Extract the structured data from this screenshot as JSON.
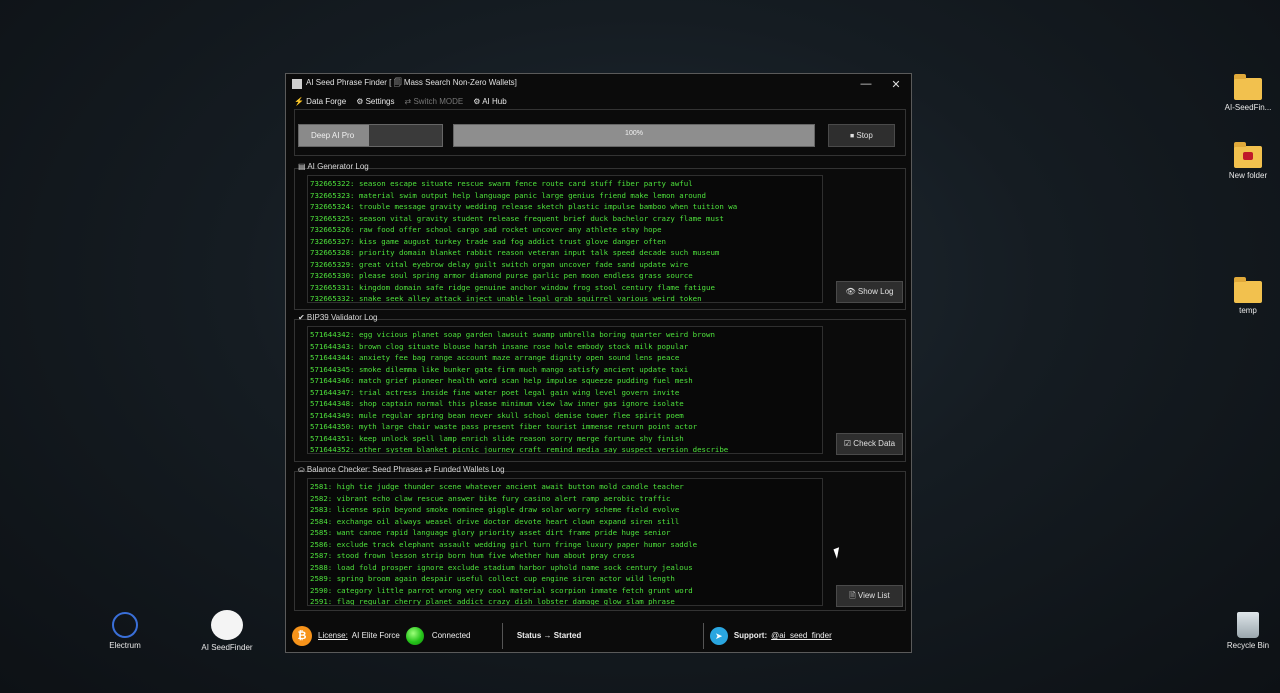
{
  "window": {
    "title": "AI Seed Phrase Finder [ 🗐 Mass Search Non-Zero Wallets]",
    "minimize": "—",
    "close": "✕"
  },
  "menu": {
    "data_forge": "⚡ Data Forge",
    "settings": "⚙ Settings",
    "switch_mode": "⇄ Switch MODE",
    "ai_hub": "⚙ AI Hub"
  },
  "controls": {
    "mode_selected": "Deep AI Pro",
    "progress_text": "100%",
    "progress_fraction": 1.0,
    "stop_label": "⏹ Stop"
  },
  "generator": {
    "label": "▤ AI Generator Log",
    "button": "👁 Show Log",
    "lines": [
      "732665322: season escape situate rescue swarm fence route card stuff fiber party awful",
      "732665323: material swim output help language panic large genius friend make lemon around",
      "732665324: trouble message gravity wedding release sketch plastic impulse bamboo when tuition wa",
      "732665325: season vital gravity student release frequent brief duck bachelor crazy flame must",
      "732665326: raw food offer school cargo sad rocket uncover any athlete stay hope",
      "732665327: kiss game august turkey trade sad fog addict trust glove danger often",
      "732665328: priority domain blanket rabbit reason veteran input talk speed decade such museum",
      "732665329: great vital eyebrow delay guilt switch organ uncover fade sand update wire",
      "732665330: please soul spring armor diamond purse garlic pen moon endless grass source",
      "732665331: kingdom domain safe ridge genuine anchor window frog stool century flame fatigue",
      "732665332: snake seek alley attack inject unable legal grab squirrel various weird token"
    ]
  },
  "validator": {
    "label": "✔ BIP39 Validator Log",
    "button": "☑ Check Data",
    "lines": [
      "571644342: egg vicious planet soap garden lawsuit swamp umbrella boring quarter weird brown",
      "571644343: brown clog situate blouse harsh insane rose hole embody stock milk popular",
      "571644344: anxiety fee bag range account maze arrange dignity open sound lens peace",
      "571644345: smoke dilemma like bunker gate firm much mango satisfy ancient update taxi",
      "571644346: match grief pioneer health word scan help impulse squeeze pudding fuel mesh",
      "571644347: trial actress inside fine water poet legal gain wing level govern invite",
      "571644348: shop captain normal this please minimum view law inner gas ignore isolate",
      "571644349: mule regular spring bean never skull school demise tower flee spirit poem",
      "571644350: myth large chair waste pass present fiber tourist immense return point actor",
      "571644351: keep unlock spell lamp enrich slide reason sorry merge fortune shy finish",
      "571644352: other system blanket picnic journey craft remind media say suspect version describe"
    ]
  },
  "balance": {
    "label": "⛀ Balance Checker: Seed Phrases ⇄ Funded Wallets Log",
    "button": "🗎 View List",
    "lines": [
      "2581: high tie judge thunder scene whatever ancient await button mold candle teacher",
      "2582: vibrant echo claw rescue answer bike fury casino alert ramp aerobic traffic",
      "2583: license spin beyond smoke nominee giggle draw solar worry scheme field evolve",
      "2584: exchange oil always weasel drive doctor devote heart clown expand siren still",
      "2585: want canoe rapid language glory priority asset dirt frame pride huge senior",
      "2586: exclude track elephant assault wedding girl turn fringe luxury paper humor saddle",
      "2587: stood frown lesson strip born hum five whether hum about pray cross",
      "2588: load fold prosper ignore exclude stadium harbor uphold name sock century jealous",
      "2589: spring broom again despair useful collect cup engine siren actor wild length",
      "2590: category little parrot wrong very cool material scorpion inmate fetch grunt word",
      "2591: flag regular cherry planet addict crazy dish lobster damage glow slam phrase"
    ]
  },
  "status": {
    "btc_glyph": "₿",
    "license_label": "License:",
    "license_value": "AI Elite Force",
    "connection": "Connected",
    "status_text": "Status → Started",
    "tg_glyph": "➤",
    "support_label": "Support:",
    "support_value": "@ai_seed_finder"
  },
  "desktop": {
    "icons": [
      {
        "label": "AI-SeedFin..."
      },
      {
        "label": "New folder"
      },
      {
        "label": "temp"
      },
      {
        "label": "Recycle Bin"
      },
      {
        "label": "Electrum"
      },
      {
        "label": "AI SeedFinder"
      }
    ]
  }
}
